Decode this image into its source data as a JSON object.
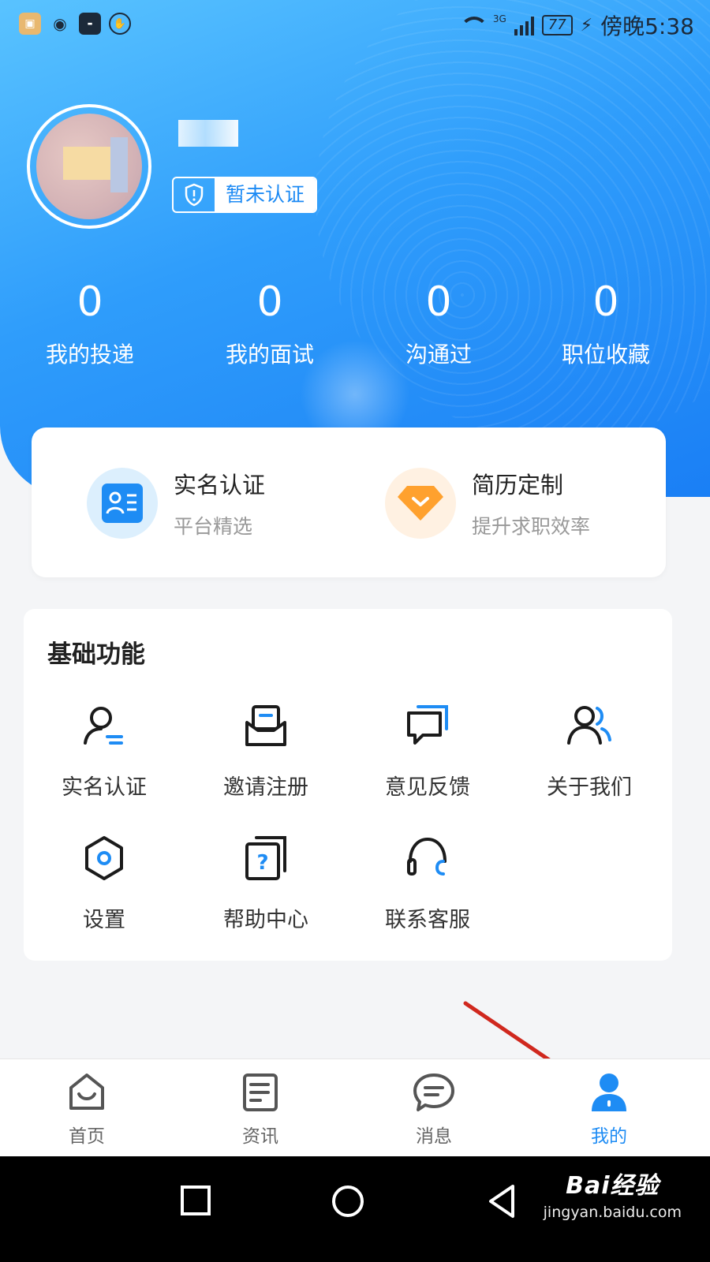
{
  "status_bar": {
    "network_label": "3G",
    "battery": "77",
    "time": "傍晚5:38"
  },
  "profile": {
    "username": "",
    "verify_status": "暂未认证"
  },
  "stats": [
    {
      "value": "0",
      "label": "我的投递"
    },
    {
      "value": "0",
      "label": "我的面试"
    },
    {
      "value": "0",
      "label": "沟通过"
    },
    {
      "value": "0",
      "label": "职位收藏"
    }
  ],
  "quick_cards": [
    {
      "title": "实名认证",
      "subtitle": "平台精选",
      "icon": "id-card-icon",
      "color": "#1e8cf4"
    },
    {
      "title": "简历定制",
      "subtitle": "提升求职效率",
      "icon": "diamond-icon",
      "color": "#ffa12e"
    }
  ],
  "basic_functions": {
    "title": "基础功能",
    "items": [
      {
        "label": "实名认证",
        "icon": "user-verify-icon"
      },
      {
        "label": "邀请注册",
        "icon": "invite-envelope-icon"
      },
      {
        "label": "意见反馈",
        "icon": "feedback-chat-icon"
      },
      {
        "label": "关于我们",
        "icon": "about-users-icon"
      },
      {
        "label": "设置",
        "icon": "settings-hexagon-icon"
      },
      {
        "label": "帮助中心",
        "icon": "help-question-icon"
      },
      {
        "label": "联系客服",
        "icon": "headset-icon"
      }
    ]
  },
  "bottom_nav": [
    {
      "label": "首页",
      "icon": "home-icon",
      "active": false
    },
    {
      "label": "资讯",
      "icon": "news-icon",
      "active": false
    },
    {
      "label": "消息",
      "icon": "message-icon",
      "active": false
    },
    {
      "label": "我的",
      "icon": "profile-icon",
      "active": true
    }
  ],
  "watermark": {
    "main": "Bai经验",
    "sub": "jingyan.baidu.com"
  },
  "colors": {
    "accent": "#1e8cf4",
    "header_gradient_start": "#59c3ff",
    "header_gradient_end": "#1a7ff5",
    "annotation_arrow": "#d0281e"
  }
}
